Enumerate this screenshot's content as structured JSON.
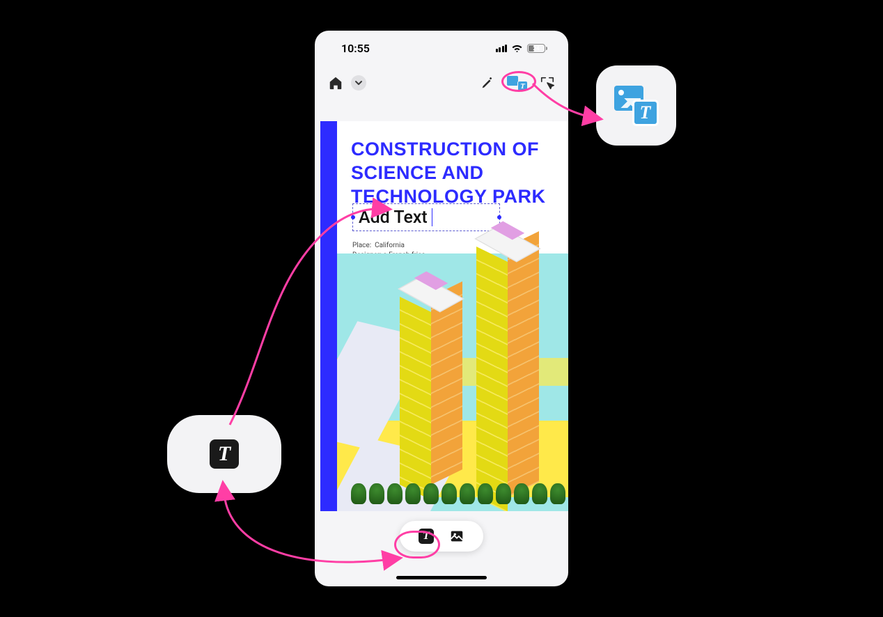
{
  "status_bar": {
    "time": "10:55",
    "battery_percent": "24"
  },
  "toolbar": {
    "home_icon": "home-icon",
    "chevron_icon": "chevron-down-icon",
    "highlighter_icon": "highlighter-icon",
    "image_text_icon": "image-text-icon",
    "selection_icon": "selection-touch-icon"
  },
  "document": {
    "title": "CONSTRUCTION OF SCIENCE AND TECHNOLOGY PARK",
    "add_text_placeholder": "Add Text",
    "meta_place_label": "Place:",
    "meta_place_value": "California",
    "meta_designer_label": "Designer:",
    "meta_designer_value": "a French fries"
  },
  "bottom_bar": {
    "text_tool_icon": "text-tool-icon",
    "image_tool_icon": "image-tool-icon"
  },
  "callouts": {
    "right_icon": "image-text-icon",
    "left_icon": "text-tool-icon"
  }
}
